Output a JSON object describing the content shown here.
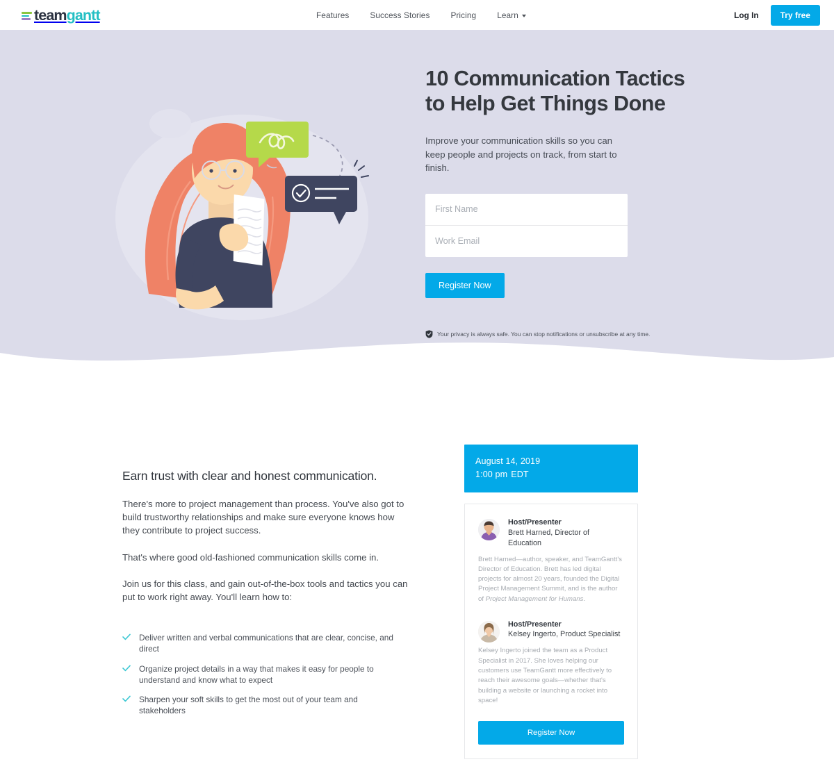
{
  "brand": {
    "logo_text_1": "team",
    "logo_text_2": "gantt",
    "accent_blue": "#03a9e8",
    "accent_teal": "#24bfc4",
    "hero_bg": "#dcdcea",
    "heading_color": "#34383e"
  },
  "header": {
    "nav": [
      {
        "label": "Features",
        "has_caret": false
      },
      {
        "label": "Success Stories",
        "has_caret": false
      },
      {
        "label": "Pricing",
        "has_caret": false
      },
      {
        "label": "Learn",
        "has_caret": true
      }
    ],
    "login_label": "Log In",
    "try_free_label": "Try free"
  },
  "hero": {
    "title_line_1": "10 Communication Tactics",
    "title_line_2": "to Help Get Things Done",
    "subtitle": "Improve your communication skills so you can keep people and projects on track, from start to finish.",
    "form": {
      "first_name_placeholder": "First Name",
      "first_name_value": "",
      "work_email_placeholder": "Work Email",
      "work_email_value": "",
      "submit_label": "Register Now"
    },
    "privacy_note": "Your privacy is always safe. You can stop notifications or unsubscribe at any time.",
    "privacy_icon": "shield-icon",
    "illustration": {
      "name": "woman-with-document-and-speech-bubbles",
      "green_bubble_color": "#b5d94a",
      "dark_bubble_color": "#3f4560",
      "hair_color": "#ef8266",
      "shirt_color": "#3f4560",
      "skin_color": "#fbd9ab"
    }
  },
  "main": {
    "section_title": "Earn trust with clear and honest communication.",
    "paragraphs": [
      "There's more to project management than process. You've also got to build trustworthy relationships and make sure everyone knows how they contribute to project success.",
      "That's where good old-fashioned communication skills come in.",
      "Join us for this class, and gain out-of-the-box tools and tactics you can put to work right away. You'll learn how to:"
    ],
    "checklist": [
      "Deliver written and verbal communications that are clear, concise, and direct",
      "Organize project details in a way that makes it easy for people to understand and know what to expect",
      "Sharpen your soft skills to get the most out of your team and stakeholders"
    ],
    "check_icon": "checkmark-icon"
  },
  "event_card": {
    "date": "August 14, 2019",
    "time": "1:00 pm",
    "timezone": "EDT",
    "presenters": [
      {
        "role": "Host/Presenter",
        "name": "Brett Harned, Director of Education",
        "bio_before_italic": "Brett Harned—author, speaker, and TeamGantt's Director of Education. Brett has led digital projects for almost 20 years, founded the Digital Project Management Summit, and is the author of ",
        "bio_italic": "Project Management for Humans",
        "bio_after_italic": ".",
        "avatar_name": "avatar-brett-harned",
        "avatar_shirt_color": "#8a5fb0",
        "avatar_skin_color": "#e8b48d",
        "avatar_hair_color": "#4a3a32"
      },
      {
        "role": "Host/Presenter",
        "name": "Kelsey Ingerto, Product Specialist",
        "bio_before_italic": "Kelsey Ingerto joined the team as a Product Specialist in 2017. She loves helping our customers use TeamGantt more effectively to reach their awesome goals—whether that's building a website or launching a rocket into space!",
        "bio_italic": "",
        "bio_after_italic": "",
        "avatar_name": "avatar-kelsey-ingerto",
        "avatar_shirt_color": "#c8b9a6",
        "avatar_skin_color": "#f0c9a8",
        "avatar_hair_color": "#8a6a4a"
      }
    ],
    "register_label": "Register Now"
  }
}
